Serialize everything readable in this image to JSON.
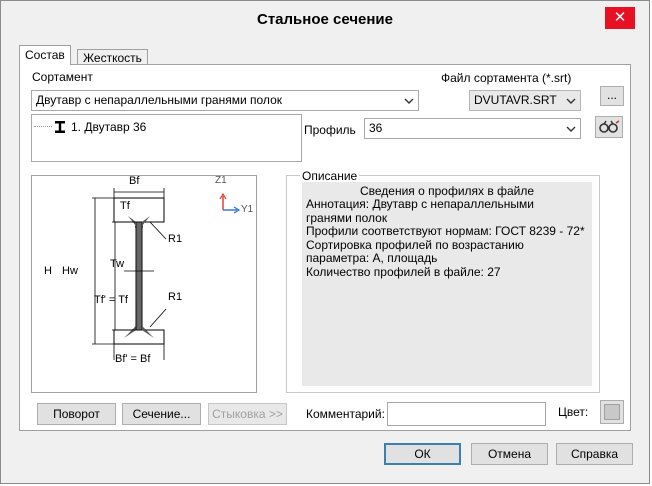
{
  "window": {
    "title": "Стальное сечение",
    "close_glyph": "✕"
  },
  "tabs": [
    {
      "label": "Состав",
      "active": true
    },
    {
      "label": "Жесткость",
      "active": false
    }
  ],
  "assortment": {
    "label": "Сортамент",
    "value": "Двутавр  с  непараллельными  гранями  полок"
  },
  "file": {
    "label": "Файл сортамента (*.srt)",
    "value": "DVUTAVR.SRT",
    "browse_label": "..."
  },
  "tree": {
    "items": [
      {
        "label": "1. Двутавр 36"
      }
    ]
  },
  "profile": {
    "label": "Профиль",
    "value": "36"
  },
  "diagram": {
    "labels": {
      "bf_top": "Bf",
      "tf": "Tf",
      "r1_top": "R1",
      "h": "H",
      "hw": "Hw",
      "tw": "Tw",
      "tf_eq": "Tf' = Tf",
      "r1_bottom": "R1",
      "bf_eq": "Bf' = Bf",
      "axis_z": "Z1",
      "axis_y": "Y1"
    }
  },
  "description": {
    "label": "Описание",
    "heading": "Сведения о профилях в файле",
    "lines": [
      "Аннотация: Двутавр  с  непараллельными",
      "гранями  полок",
      "Профили соответствуют нормам: ГОСТ 8239 - 72*",
      "Сортировка профилей по возрастанию",
      "параметра: А, площадь",
      "Количество профилей в файле: 27"
    ]
  },
  "buttons": {
    "rotate": "Поворот",
    "section": "Сечение...",
    "dock": "Стыковка >>",
    "ok": "ОК",
    "cancel": "Отмена",
    "help": "Справка"
  },
  "comment": {
    "label": "Комментарий:",
    "value": ""
  },
  "color": {
    "label": "Цвет:",
    "swatch": "#c8c8c8"
  },
  "colors": {
    "accent": "#3c7fb1",
    "close": "#e81123",
    "axis_z": "#e03030",
    "axis_y": "#2a6fd0"
  }
}
